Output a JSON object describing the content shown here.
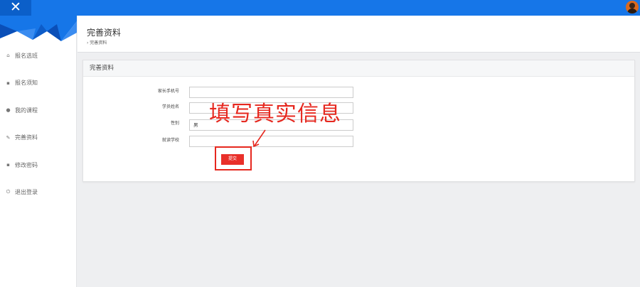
{
  "topbar": {
    "close_icon": "✕",
    "accent_color": "#1676e8"
  },
  "sidebar": {
    "items": [
      {
        "icon": "home-icon",
        "glyph": "⌂",
        "label": "报名选班"
      },
      {
        "icon": "file-icon",
        "glyph": "▪",
        "label": "报名须知"
      },
      {
        "icon": "user-icon",
        "glyph": "●",
        "label": "我的课程"
      },
      {
        "icon": "edit-icon",
        "glyph": "✎",
        "label": "完善资料"
      },
      {
        "icon": "lock-icon",
        "glyph": "▪",
        "label": "修改密码"
      },
      {
        "icon": "power-icon",
        "glyph": "⏻",
        "label": "退出登录"
      }
    ]
  },
  "header": {
    "title": "完善资料",
    "breadcrumb": "› 完善资料"
  },
  "form": {
    "card_title": "完善资料",
    "fields": [
      {
        "label": "家长手机号",
        "value": ""
      },
      {
        "label": "学员姓名",
        "value": ""
      },
      {
        "label": "性别",
        "value": "男"
      },
      {
        "label": "就读学校",
        "value": ""
      }
    ],
    "submit_label": "提交"
  },
  "annotation": {
    "text": "填写真实信息",
    "color": "#e6281f"
  }
}
